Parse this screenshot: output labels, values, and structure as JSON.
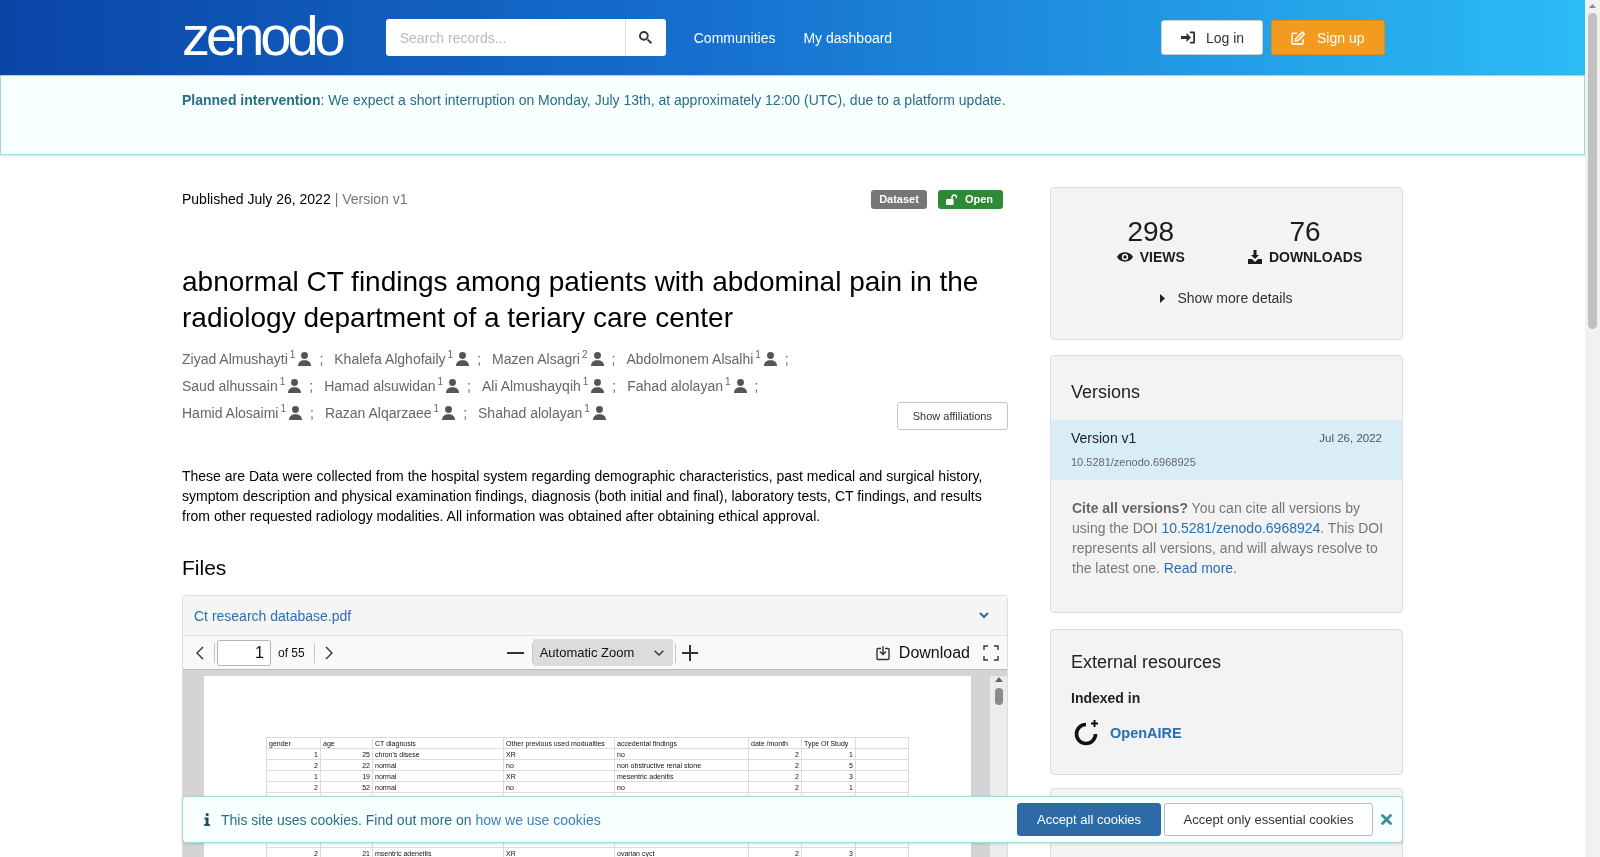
{
  "header": {
    "logo": "zenodo",
    "search": {
      "placeholder": "Search records..."
    },
    "nav": [
      {
        "label": "Communities"
      },
      {
        "label": "My dashboard"
      }
    ],
    "buttons": [
      {
        "kind": "login",
        "label": "Log in"
      },
      {
        "kind": "signup",
        "label": "Sign up"
      }
    ]
  },
  "announcement": {
    "text": "**Planned intervention**: We expect a short interruption on Monday, July 13th, at approximately 12:00 (UTC), due to a platform update."
  },
  "record": {
    "published": "Published July 26, 2022",
    "version": "| Version v1",
    "badges": [
      {
        "kind": "type",
        "label": "Dataset"
      },
      {
        "kind": "access",
        "label": "Open"
      }
    ],
    "title": "abnormal CT findings among patients with abdominal pain in the radiology department of a teriary care center",
    "authors": [
      {
        "name": "Ziyad Almushayti$^{1}$",
        "separator": ";"
      },
      {
        "name": "Khalefa Alghofaily$^{1}$",
        "separator": ";"
      },
      {
        "name": "Mazen Alsagri$^{2}$",
        "separator": ";"
      },
      {
        "name": "Abdolmonem Alsalhi$^{1}$",
        "separator": ";"
      },
      {
        "name": "Saud alhussain$^{1}$",
        "separator": ";"
      },
      {
        "name": "Hamad alsuwidan$^{1}$",
        "separator": ";"
      },
      {
        "name": "Ali Almushayqih$^{1}$",
        "separator": ";"
      },
      {
        "name": "Fahad alolayan$^{1}$",
        "separator": ";"
      },
      {
        "name": "Hamid Alosaimi$^{1}$",
        "separator": ";"
      },
      {
        "name": "Razan Alqarzaee$^{1}$",
        "separator": ";"
      },
      {
        "name": "Shahad alolayan$^{1}$"
      }
    ],
    "show_affiliations": "Show affiliations",
    "description": "These are Data were collected from the hospital system regarding demographic characteristics, past medical and surgical history, symptom description and physical examination findings, diagnosis (both initial and final), laboratory tests, CT findings, and results from other requested radiology modalities. All information was obtained after obtaining ethical approval."
  },
  "files": {
    "heading": "Files",
    "file_name": "Ct research database.pdf",
    "viewer": {
      "page_number": "1",
      "page_count": "of 55",
      "zoom": "Automatic Zoom",
      "download": "Download",
      "table": {
        "columns": [
          {
            "label": "gender",
            "kind": "number"
          },
          {
            "label": "age",
            "kind": "number"
          },
          {
            "label": "CT diagnosis",
            "kind": "text"
          },
          {
            "label": "Other previous used modualties",
            "kind": "text"
          },
          {
            "label": "accedental findings",
            "kind": "text"
          },
          {
            "label": "date /month",
            "kind": "number"
          },
          {
            "label": "Type Of Study",
            "kind": "number"
          }
        ],
        "rows": [
          [
            "1",
            "25",
            "chron's disese",
            "XR",
            "no",
            "2",
            "1"
          ],
          [
            "2",
            "22",
            "normal",
            "no",
            "non obstructive renal stone",
            "2",
            "5"
          ],
          [
            "1",
            "19",
            "normal",
            "XR",
            "mesentric adenitis",
            "2",
            "3"
          ],
          [
            "2",
            "52",
            "normal",
            "no",
            "no",
            "2",
            "1"
          ]
        ],
        "rows_below_banner": [
          [
            "2",
            "21",
            "msentric adeneitis",
            "XR",
            "ovarian cyct",
            "2",
            "3"
          ]
        ]
      }
    }
  },
  "sidebar": {
    "stats": [
      {
        "kind": "views",
        "value": "298",
        "label": "VIEWS"
      },
      {
        "kind": "downloads",
        "value": "76",
        "label": "DOWNLOADS"
      }
    ],
    "show_more": "Show more details",
    "versions": {
      "heading": "Versions",
      "items": [
        {
          "label": "Version v1",
          "date": "Jul 26, 2022",
          "doi": "10.5281/zenodo.6968925",
          "selected": true
        }
      ],
      "cite": {
        "lead": "Cite all versions?",
        "text": " You can cite all versions by using the DOI ",
        "doi": "10.5281/zenodo.6968924",
        "text_after_doi": ". This DOI represents all versions, and will always resolve to the latest one. ",
        "link": "Read more",
        "end": "."
      }
    },
    "external": {
      "heading": "External resources",
      "subheading": "Indexed in",
      "links": [
        {
          "label": "OpenAIRE"
        }
      ]
    }
  },
  "cookie_banner": {
    "text": "This site uses cookies. Find out more on ",
    "link": "how we use cookies",
    "buttons": [
      {
        "kind": "primary",
        "label": "Accept all cookies"
      },
      {
        "kind": "secondary",
        "label": "Accept only essential cookies"
      }
    ]
  }
}
